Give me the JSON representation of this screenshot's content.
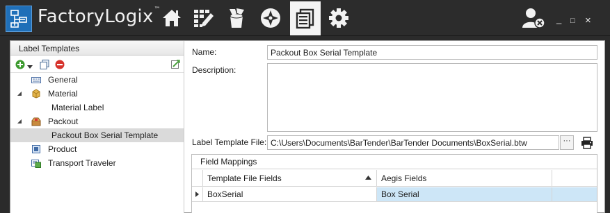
{
  "app": {
    "brand_prefix": "Factory",
    "brand_suffix": "Logix",
    "brand_tm": "™",
    "nav_icons": [
      "home-icon",
      "edit-grid-icon",
      "recycle-bin-icon",
      "compass-icon",
      "documents-icon",
      "gear-icon"
    ],
    "active_nav": "documents-icon",
    "window_controls": {
      "minimize": "_",
      "maximize": "□",
      "close": "×"
    }
  },
  "left_panel": {
    "title": "Label Templates",
    "toolbar": [
      "add-icon",
      "dropdown-icon",
      "copy-icon",
      "delete-icon",
      "export-icon"
    ],
    "tree": [
      {
        "label": "General",
        "level": 0,
        "expandable": false,
        "icon": "label-icon"
      },
      {
        "label": "Material",
        "level": 0,
        "expandable": true,
        "expanded": true,
        "icon": "material-icon"
      },
      {
        "label": "Material Label",
        "level": 1,
        "expandable": false,
        "icon": ""
      },
      {
        "label": "Packout",
        "level": 0,
        "expandable": true,
        "expanded": true,
        "icon": "packout-icon"
      },
      {
        "label": "Packout Box Serial Template",
        "level": 1,
        "expandable": false,
        "icon": "",
        "selected": true
      },
      {
        "label": "Product",
        "level": 0,
        "expandable": false,
        "icon": "product-icon"
      },
      {
        "label": "Transport Traveler",
        "level": 0,
        "expandable": false,
        "icon": "transport-icon"
      }
    ]
  },
  "details": {
    "name_label": "Name:",
    "name_value": "Packout Box Serial Template",
    "description_label": "Description:",
    "description_value": "",
    "file_label": "Label Template File:",
    "file_value": "C:\\Users\\Documents\\BarTender\\BarTender Documents\\BoxSerial.btw",
    "browse_label": "···"
  },
  "field_mappings": {
    "title": "Field Mappings",
    "columns": [
      "Template File Fields",
      "Aegis Fields"
    ],
    "rows": [
      {
        "template_field": "BoxSerial",
        "aegis_field": "Box Serial"
      }
    ]
  },
  "colors": {
    "topbar": "#2c2c2c",
    "logo_blue": "#1f6fb8",
    "selection_gray": "#dadada",
    "grid_selection": "#cde6f7"
  }
}
